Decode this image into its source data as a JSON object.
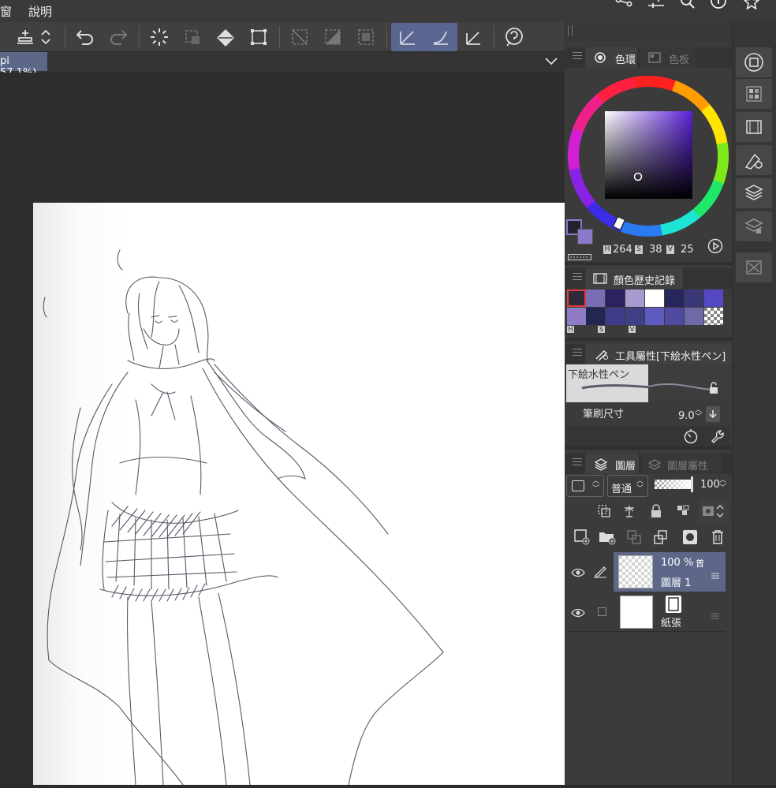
{
  "menu": {
    "window": "窗",
    "help": "說明"
  },
  "document_tab": {
    "label": "pi 57.1%)"
  },
  "top_right_icons": [
    "share-icon",
    "adjust-icon",
    "search-icon",
    "info-icon",
    "star-icon"
  ],
  "color_panel": {
    "tab_wheel": "色環",
    "tab_palette": "色板",
    "h_label": "H",
    "h_value": "264",
    "s_label": "S",
    "s_value": "38",
    "v_label": "V",
    "v_value": "25",
    "main_color": "#252230",
    "sub_color": "#8b78c8"
  },
  "history_panel": {
    "title": "顏色歷史記錄",
    "row1": [
      "#2d2a3a",
      "#7b6db3",
      "#2e2160",
      "#a79ad1",
      "#ffffff",
      "#27265a",
      "#3b3878",
      "#5448c4"
    ],
    "row2": [
      "#8e7cc5",
      "#22274f",
      "#3f3c8c",
      "#3e3f85",
      "#5d5ac0",
      "#4f4aa0",
      "#6e6aa8",
      "checker"
    ],
    "labels": [
      "H",
      "S",
      "V"
    ]
  },
  "tool_property": {
    "title": "工具屬性[下絵水性ペン]",
    "preset_name": "下絵水性ペン",
    "brush_size_label": "筆刷尺寸",
    "brush_size_value": "9.0"
  },
  "layer_panel": {
    "tab_layer": "圖層",
    "tab_layer_property": "圖層屬性",
    "blend_mode": "普通",
    "opacity": "100",
    "layers": [
      {
        "opacity": "100 %",
        "mode_short": "普",
        "name": "圖層 1",
        "selected": true
      },
      {
        "name": "紙張",
        "selected": false
      }
    ]
  }
}
